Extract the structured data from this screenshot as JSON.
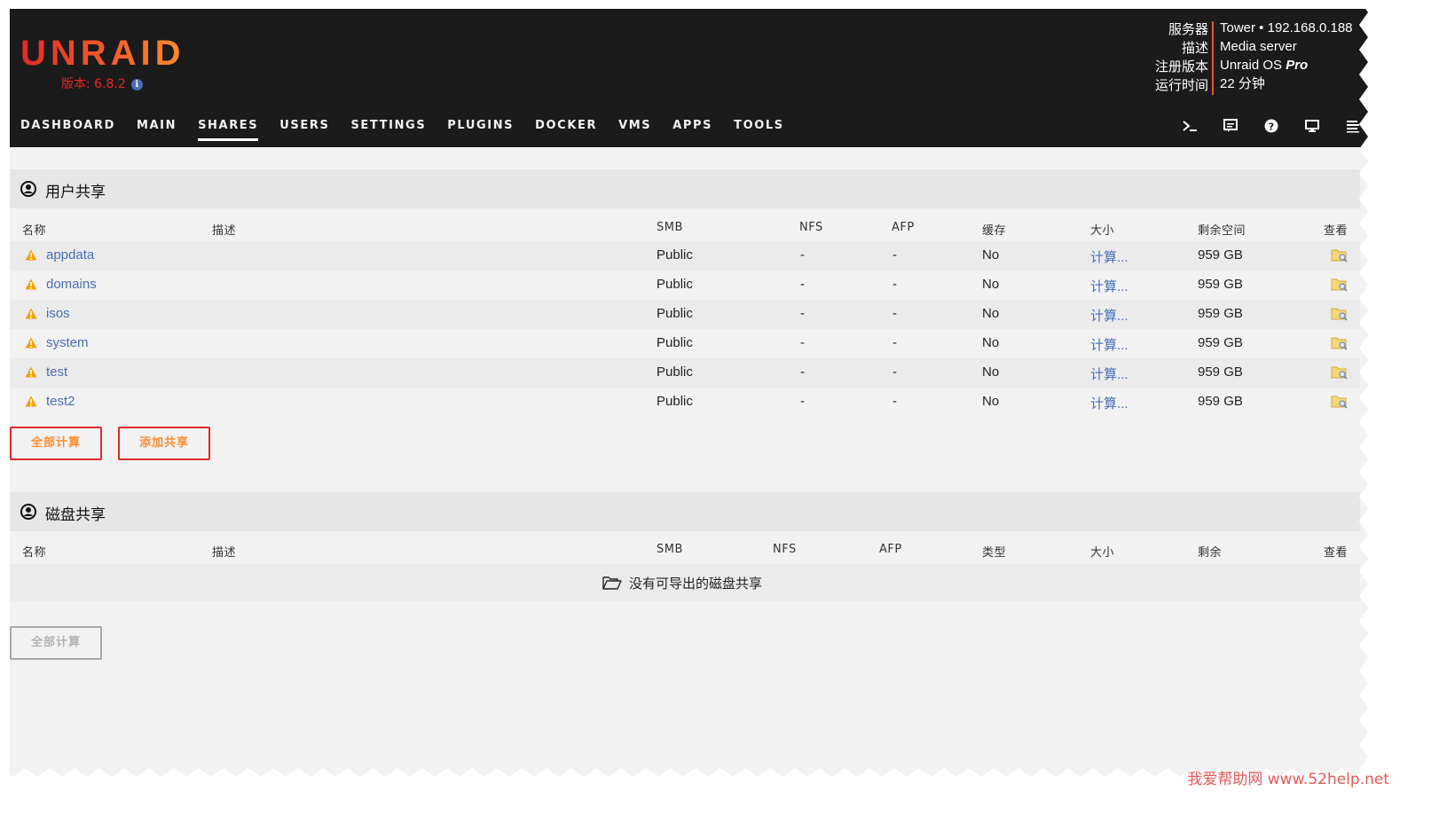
{
  "header": {
    "logo": "UNRAID",
    "version_label": "版本: 6.8.2",
    "server_info": {
      "labels": [
        "服务器",
        "描述",
        "注册版本",
        "运行时间"
      ],
      "server": "Tower • 192.168.0.188",
      "description": "Media server",
      "registration_prefix": "Unraid OS ",
      "registration_edition": "Pro",
      "uptime": "22 分钟"
    }
  },
  "nav": {
    "items": [
      "DASHBOARD",
      "MAIN",
      "SHARES",
      "USERS",
      "SETTINGS",
      "PLUGINS",
      "DOCKER",
      "VMS",
      "APPS",
      "TOOLS"
    ],
    "active": "SHARES",
    "icons": [
      "terminal-icon",
      "feedback-icon",
      "help-icon",
      "monitor-icon",
      "log-icon"
    ]
  },
  "user_shares": {
    "title": "用户共享",
    "columns": [
      "名称",
      "描述",
      "SMB",
      "NFS",
      "AFP",
      "缓存",
      "大小",
      "剩余空间",
      "查看"
    ],
    "rows": [
      {
        "name": "appdata",
        "description": "",
        "smb": "Public",
        "nfs": "-",
        "afp": "-",
        "cache": "No",
        "size": "计算...",
        "free": "959 GB"
      },
      {
        "name": "domains",
        "description": "",
        "smb": "Public",
        "nfs": "-",
        "afp": "-",
        "cache": "No",
        "size": "计算...",
        "free": "959 GB"
      },
      {
        "name": "isos",
        "description": "",
        "smb": "Public",
        "nfs": "-",
        "afp": "-",
        "cache": "No",
        "size": "计算...",
        "free": "959 GB"
      },
      {
        "name": "system",
        "description": "",
        "smb": "Public",
        "nfs": "-",
        "afp": "-",
        "cache": "No",
        "size": "计算...",
        "free": "959 GB"
      },
      {
        "name": "test",
        "description": "",
        "smb": "Public",
        "nfs": "-",
        "afp": "-",
        "cache": "No",
        "size": "计算...",
        "free": "959 GB"
      },
      {
        "name": "test2",
        "description": "",
        "smb": "Public",
        "nfs": "-",
        "afp": "-",
        "cache": "No",
        "size": "计算...",
        "free": "959 GB"
      }
    ],
    "compute_all_button": "全部计算",
    "add_share_button": "添加共享"
  },
  "disk_shares": {
    "title": "磁盘共享",
    "columns": [
      "名称",
      "描述",
      "SMB",
      "NFS",
      "AFP",
      "类型",
      "大小",
      "剩余",
      "查看"
    ],
    "empty_message": "没有可导出的磁盘共享",
    "compute_all_button": "全部计算"
  },
  "watermark": "我爱帮助网 www.52help.net",
  "colors": {
    "header_bg": "#1c1b1b",
    "brand_red": "#e22828",
    "brand_orange": "#ff8c2f",
    "link_blue": "#486dba",
    "warning_orange": "#f0a30a"
  }
}
